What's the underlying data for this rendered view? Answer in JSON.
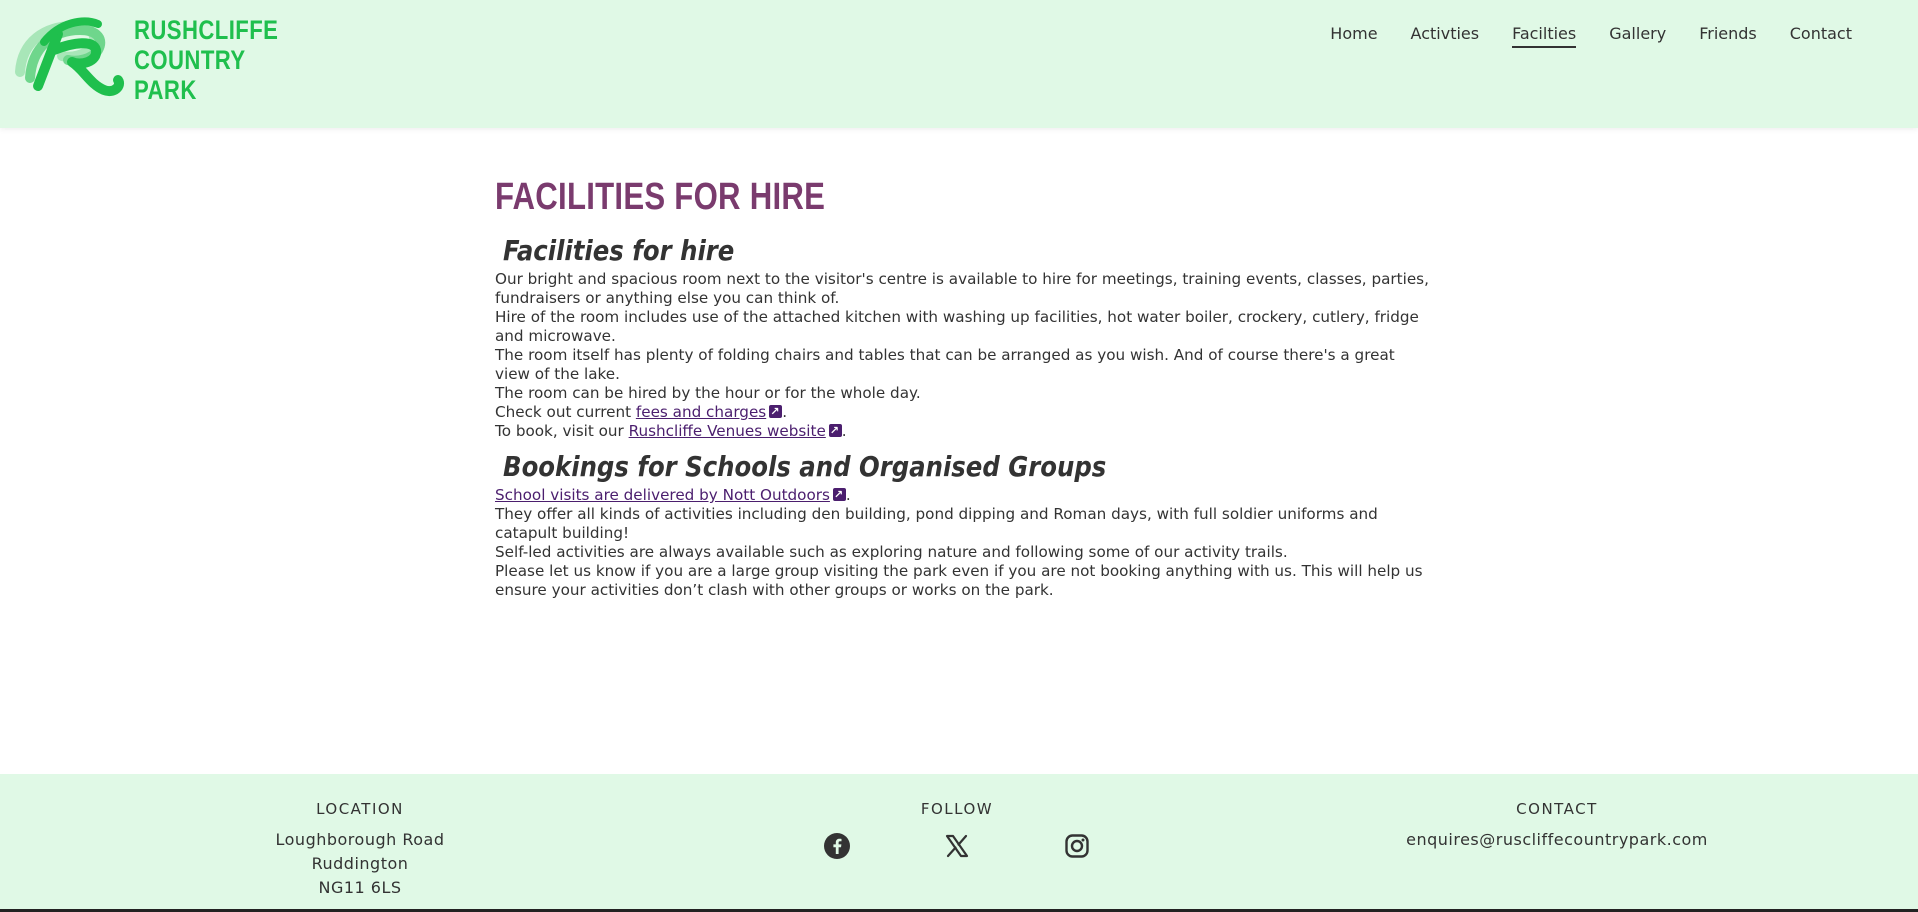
{
  "brand": {
    "line1": "RUSHCLIFFE",
    "line2": "COUNTRY",
    "line3": "PARK",
    "logo_icon": "rushcliffe-r-logo",
    "color": "#1fbf4d"
  },
  "nav": {
    "items": [
      {
        "label": "Home"
      },
      {
        "label": "Activties"
      },
      {
        "label": "Facilties"
      },
      {
        "label": "Gallery"
      },
      {
        "label": "Friends"
      },
      {
        "label": "Contact"
      }
    ],
    "active": "Facilties"
  },
  "main": {
    "page_title": "FACILITIES FOR HIRE",
    "section1": {
      "title": "Facilities for hire",
      "p1": "Our bright and spacious room next to the visitor's centre is available to hire for meetings, training events, classes, parties, fundraisers or anything else you can think of.",
      "p2": "Hire of the room includes use of the attached kitchen with washing up facilities, hot water boiler, crockery, cutlery, fridge and microwave.",
      "p3": "The room itself has plenty of folding chairs and tables that can be arranged as you wish. And of course there's a great view of the lake.",
      "p4": "The room can be hired by the hour or for the whole day.",
      "p5_prefix": "Check out current ",
      "p5_link": "fees and charges",
      "p5_suffix": ".",
      "p6_prefix": "To book, visit our ",
      "p6_link": "Rushcliffe Venues website",
      "p6_suffix": "."
    },
    "section2": {
      "title": "Bookings for Schools and Organised Groups",
      "p1_link": "School visits are delivered by Nott Outdoors",
      "p1_suffix": ".",
      "p2": "They offer all kinds of activities including den building, pond dipping and Roman days, with full soldier uniforms and catapult building!",
      "p3": "Self-led activities are always available such as exploring nature and following some of our activity trails.",
      "p4": "Please let us know if you are a large group visiting the park even if you are not booking anything with us. This will help us ensure your activities don’t clash with other groups or works on the park."
    },
    "title_color": "#7a3b6e",
    "link_color": "#4b1e6e"
  },
  "footer": {
    "location": {
      "title": "LOCATION",
      "line1": "Loughborough Road",
      "line2": "Ruddington",
      "line3": "NG11 6LS"
    },
    "follow": {
      "title": "FOLLOW",
      "icons": [
        "facebook-icon",
        "x-icon",
        "instagram-icon"
      ]
    },
    "contact": {
      "title": "CONTACT",
      "email": "enquires@ruscliffecountrypark.com"
    },
    "background": "#e0f9e6"
  }
}
